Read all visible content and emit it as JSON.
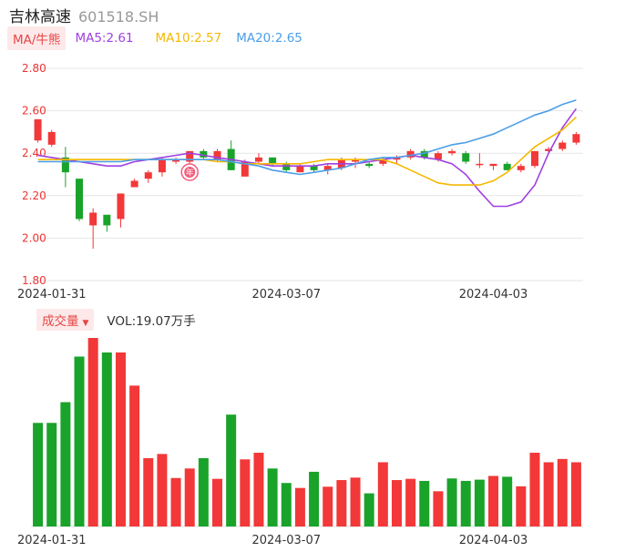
{
  "header": {
    "stock_name": "吉林高速",
    "stock_code": "601518.SH"
  },
  "ma_legend": {
    "toggle_label": "MA/牛熊",
    "items": [
      {
        "text": "MA5:2.61",
        "color": "#a040e0"
      },
      {
        "text": "MA10:2.57",
        "color": "#f5b800"
      },
      {
        "text": "MA20:2.65",
        "color": "#4a9ee8"
      }
    ]
  },
  "volume_legend": {
    "selector_label": "成交量",
    "value_text": "VOL:19.07万手"
  },
  "colors": {
    "up": "#f23838",
    "down": "#1aa32a",
    "grid": "#e6e6e6",
    "ma5": "#a040e0",
    "ma10": "#f5b800",
    "ma20": "#4a9ee8",
    "badge": "#f25a7a"
  },
  "badge_text": "年",
  "chart_data": [
    {
      "type": "candlestick",
      "title": "",
      "ylim": [
        1.8,
        2.8
      ],
      "y_ticks": [
        "2.80",
        "2.60",
        "2.40",
        "2.20",
        "2.00",
        "1.80"
      ],
      "x_tick_labels": [
        {
          "index": 1,
          "label": "2024-01-31"
        },
        {
          "index": 18,
          "label": "2024-03-07"
        },
        {
          "index": 33,
          "label": "2024-04-03"
        }
      ],
      "candles": [
        {
          "o": 2.46,
          "c": 2.56,
          "h": 2.56,
          "l": 2.45
        },
        {
          "o": 2.44,
          "c": 2.5,
          "h": 2.51,
          "l": 2.43
        },
        {
          "o": 2.38,
          "c": 2.31,
          "h": 2.43,
          "l": 2.24
        },
        {
          "o": 2.28,
          "c": 2.09,
          "h": 2.28,
          "l": 2.08
        },
        {
          "o": 2.06,
          "c": 2.12,
          "h": 2.14,
          "l": 1.95
        },
        {
          "o": 2.11,
          "c": 2.06,
          "h": 2.11,
          "l": 2.03
        },
        {
          "o": 2.09,
          "c": 2.21,
          "h": 2.21,
          "l": 2.05
        },
        {
          "o": 2.24,
          "c": 2.27,
          "h": 2.28,
          "l": 2.24
        },
        {
          "o": 2.28,
          "c": 2.31,
          "h": 2.32,
          "l": 2.26
        },
        {
          "o": 2.31,
          "c": 2.37,
          "h": 2.38,
          "l": 2.29
        },
        {
          "o": 2.36,
          "c": 2.37,
          "h": 2.38,
          "l": 2.35
        },
        {
          "o": 2.36,
          "c": 2.41,
          "h": 2.41,
          "l": 2.35
        },
        {
          "o": 2.41,
          "c": 2.38,
          "h": 2.42,
          "l": 2.37
        },
        {
          "o": 2.37,
          "c": 2.41,
          "h": 2.42,
          "l": 2.36
        },
        {
          "o": 2.42,
          "c": 2.32,
          "h": 2.46,
          "l": 2.32
        },
        {
          "o": 2.29,
          "c": 2.36,
          "h": 2.37,
          "l": 2.29
        },
        {
          "o": 2.36,
          "c": 2.38,
          "h": 2.4,
          "l": 2.35
        },
        {
          "o": 2.38,
          "c": 2.35,
          "h": 2.38,
          "l": 2.34
        },
        {
          "o": 2.35,
          "c": 2.32,
          "h": 2.36,
          "l": 2.31
        },
        {
          "o": 2.31,
          "c": 2.34,
          "h": 2.35,
          "l": 2.31
        },
        {
          "o": 2.34,
          "c": 2.32,
          "h": 2.35,
          "l": 2.31
        },
        {
          "o": 2.32,
          "c": 2.34,
          "h": 2.35,
          "l": 2.3
        },
        {
          "o": 2.33,
          "c": 2.37,
          "h": 2.38,
          "l": 2.32
        },
        {
          "o": 2.36,
          "c": 2.37,
          "h": 2.38,
          "l": 2.33
        },
        {
          "o": 2.35,
          "c": 2.34,
          "h": 2.36,
          "l": 2.33
        },
        {
          "o": 2.35,
          "c": 2.37,
          "h": 2.38,
          "l": 2.34
        },
        {
          "o": 2.37,
          "c": 2.38,
          "h": 2.39,
          "l": 2.35
        },
        {
          "o": 2.38,
          "c": 2.41,
          "h": 2.42,
          "l": 2.37
        },
        {
          "o": 2.41,
          "c": 2.38,
          "h": 2.42,
          "l": 2.37
        },
        {
          "o": 2.37,
          "c": 2.4,
          "h": 2.41,
          "l": 2.36
        },
        {
          "o": 2.4,
          "c": 2.41,
          "h": 2.42,
          "l": 2.39
        },
        {
          "o": 2.4,
          "c": 2.36,
          "h": 2.41,
          "l": 2.35
        },
        {
          "o": 2.35,
          "c": 2.35,
          "h": 2.4,
          "l": 2.33
        },
        {
          "o": 2.34,
          "c": 2.35,
          "h": 2.35,
          "l": 2.32
        },
        {
          "o": 2.35,
          "c": 2.32,
          "h": 2.36,
          "l": 2.32
        },
        {
          "o": 2.32,
          "c": 2.34,
          "h": 2.35,
          "l": 2.31
        },
        {
          "o": 2.34,
          "c": 2.41,
          "h": 2.41,
          "l": 2.33
        },
        {
          "o": 2.41,
          "c": 2.42,
          "h": 2.43,
          "l": 2.4
        },
        {
          "o": 2.42,
          "c": 2.45,
          "h": 2.46,
          "l": 2.41
        },
        {
          "o": 2.45,
          "c": 2.49,
          "h": 2.5,
          "l": 2.44
        }
      ],
      "series": [
        {
          "name": "MA5",
          "values": [
            2.39,
            2.38,
            2.37,
            2.36,
            2.35,
            2.34,
            2.34,
            2.36,
            2.37,
            2.38,
            2.39,
            2.4,
            2.39,
            2.38,
            2.37,
            2.36,
            2.35,
            2.34,
            2.34,
            2.34,
            2.34,
            2.35,
            2.35,
            2.35,
            2.36,
            2.37,
            2.38,
            2.39,
            2.38,
            2.37,
            2.35,
            2.3,
            2.22,
            2.15,
            2.15,
            2.17,
            2.25,
            2.4,
            2.52,
            2.61
          ]
        },
        {
          "name": "MA10",
          "values": [
            2.37,
            2.37,
            2.37,
            2.37,
            2.37,
            2.37,
            2.37,
            2.37,
            2.37,
            2.37,
            2.37,
            2.37,
            2.37,
            2.36,
            2.36,
            2.35,
            2.35,
            2.35,
            2.35,
            2.35,
            2.36,
            2.37,
            2.37,
            2.37,
            2.37,
            2.37,
            2.35,
            2.32,
            2.29,
            2.26,
            2.25,
            2.25,
            2.25,
            2.27,
            2.31,
            2.37,
            2.43,
            2.47,
            2.51,
            2.57
          ]
        },
        {
          "name": "MA20",
          "values": [
            2.36,
            2.36,
            2.36,
            2.36,
            2.36,
            2.36,
            2.36,
            2.37,
            2.37,
            2.37,
            2.37,
            2.37,
            2.37,
            2.37,
            2.36,
            2.35,
            2.34,
            2.32,
            2.31,
            2.3,
            2.31,
            2.32,
            2.33,
            2.35,
            2.37,
            2.38,
            2.38,
            2.39,
            2.4,
            2.42,
            2.44,
            2.45,
            2.47,
            2.49,
            2.52,
            2.55,
            2.58,
            2.6,
            2.63,
            2.65
          ]
        }
      ]
    },
    {
      "type": "bar",
      "title": "",
      "series_name": "成交量",
      "unit": "万手",
      "x_tick_labels": [
        {
          "index": 1,
          "label": "2024-01-31"
        },
        {
          "index": 18,
          "label": "2024-03-07"
        },
        {
          "index": 33,
          "label": "2024-04-03"
        }
      ],
      "values": [
        25.0,
        25.0,
        30.0,
        41.0,
        45.5,
        42.0,
        42.0,
        34.0,
        16.5,
        17.5,
        11.7,
        14.0,
        16.5,
        11.5,
        27.0,
        16.2,
        17.8,
        14.0,
        10.5,
        9.3,
        13.2,
        9.6,
        11.2,
        11.8,
        8.0,
        15.5,
        11.2,
        11.5,
        11.0,
        8.5,
        11.6,
        11.0,
        11.3,
        12.2,
        12.0,
        9.7,
        17.8,
        15.5,
        16.3,
        15.5
      ],
      "directions": [
        "down",
        "down",
        "down",
        "down",
        "up",
        "down",
        "up",
        "up",
        "up",
        "up",
        "up",
        "up",
        "down",
        "up",
        "down",
        "up",
        "up",
        "down",
        "down",
        "up",
        "down",
        "up",
        "up",
        "up",
        "down",
        "up",
        "up",
        "up",
        "down",
        "up",
        "down",
        "down",
        "down",
        "up",
        "down",
        "up",
        "up",
        "up",
        "up",
        "up"
      ]
    }
  ]
}
